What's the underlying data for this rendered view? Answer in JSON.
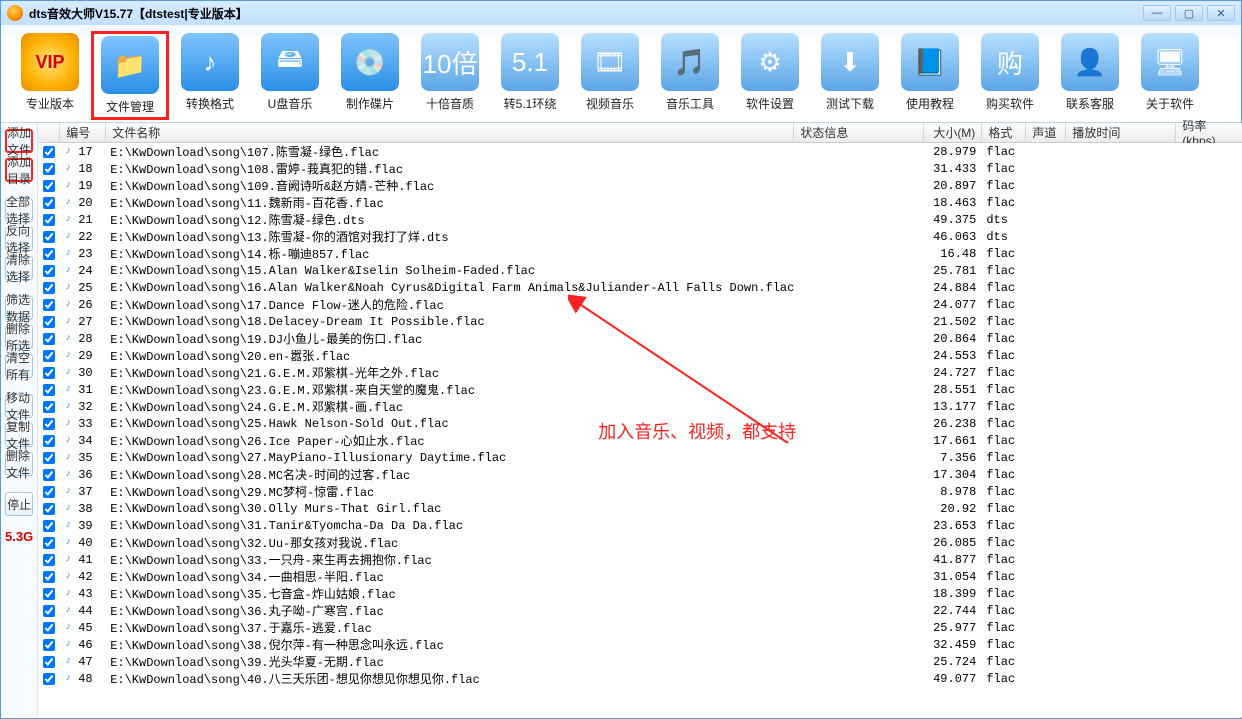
{
  "title": "dts音效大师V15.77【dtstest|专业版本】",
  "winbtns": {
    "min": "—",
    "max": "▢",
    "close": "✕"
  },
  "toolbar": [
    {
      "id": "vip",
      "label": "专业版本",
      "icon": "VIP"
    },
    {
      "id": "file-mgr",
      "label": "文件管理",
      "icon": "📁"
    },
    {
      "id": "convert",
      "label": "转换格式",
      "icon": "♪"
    },
    {
      "id": "usb",
      "label": "U盘音乐",
      "icon": "🖴"
    },
    {
      "id": "make-disc",
      "label": "制作碟片",
      "icon": "💿"
    },
    {
      "id": "ten-x",
      "label": "十倍音质",
      "icon": "10倍"
    },
    {
      "id": "to51",
      "label": "转5.1环绕",
      "icon": "5.1"
    },
    {
      "id": "video",
      "label": "视频音乐",
      "icon": "🎞"
    },
    {
      "id": "tools",
      "label": "音乐工具",
      "icon": "🎵"
    },
    {
      "id": "settings",
      "label": "软件设置",
      "icon": "⚙"
    },
    {
      "id": "test-dl",
      "label": "测试下载",
      "icon": "⬇"
    },
    {
      "id": "tutorial",
      "label": "使用教程",
      "icon": "📘"
    },
    {
      "id": "buy",
      "label": "购买软件",
      "icon": "购"
    },
    {
      "id": "contact",
      "label": "联系客服",
      "icon": "👤"
    },
    {
      "id": "about",
      "label": "关于软件",
      "icon": "🖥"
    }
  ],
  "sidebar": [
    {
      "id": "add-file",
      "label": "添加文件",
      "hl": true
    },
    {
      "id": "add-dir",
      "label": "添加目录",
      "hl": true
    },
    {
      "gap": true
    },
    {
      "id": "select-all",
      "label": "全部选择"
    },
    {
      "id": "select-inv",
      "label": "反向选择"
    },
    {
      "id": "clear-sel",
      "label": "清除选择"
    },
    {
      "gap": true
    },
    {
      "id": "filter",
      "label": "筛选数据"
    },
    {
      "id": "del-sel",
      "label": "删除所选"
    },
    {
      "id": "clear-all",
      "label": "清空所有"
    },
    {
      "gap": true
    },
    {
      "id": "move",
      "label": "移动文件"
    },
    {
      "id": "copy",
      "label": "复制文件"
    },
    {
      "id": "del-file",
      "label": "删除文件"
    },
    {
      "gap": true
    },
    {
      "id": "stop",
      "label": "停止"
    }
  ],
  "size_info": "5.3G",
  "columns": {
    "num": "编号",
    "name": "文件名称",
    "status": "状态信息",
    "size": "大小(M)",
    "fmt": "格式",
    "snd": "声道",
    "ptime": "播放时间",
    "rate": "码率(kbps)"
  },
  "annotation": "加入音乐、视频，都支持",
  "rows": [
    {
      "n": "17",
      "name": "E:\\KwDownload\\song\\107.陈雪凝-绿色.flac",
      "size": "28.979",
      "fmt": "flac"
    },
    {
      "n": "18",
      "name": "E:\\KwDownload\\song\\108.雷婷-莪真犯的错.flac",
      "size": "31.433",
      "fmt": "flac"
    },
    {
      "n": "19",
      "name": "E:\\KwDownload\\song\\109.音阙诗听&赵方婧-芒种.flac",
      "size": "20.897",
      "fmt": "flac"
    },
    {
      "n": "20",
      "name": "E:\\KwDownload\\song\\11.魏新雨-百花香.flac",
      "size": "18.463",
      "fmt": "flac"
    },
    {
      "n": "21",
      "name": "E:\\KwDownload\\song\\12.陈雪凝-绿色.dts",
      "size": "49.375",
      "fmt": "dts"
    },
    {
      "n": "22",
      "name": "E:\\KwDownload\\song\\13.陈雪凝-你的酒馆对我打了烊.dts",
      "size": "46.063",
      "fmt": "dts"
    },
    {
      "n": "23",
      "name": "E:\\KwDownload\\song\\14.栎-嘣迪857.flac",
      "size": "16.48",
      "fmt": "flac"
    },
    {
      "n": "24",
      "name": "E:\\KwDownload\\song\\15.Alan Walker&Iselin Solheim-Faded.flac",
      "size": "25.781",
      "fmt": "flac"
    },
    {
      "n": "25",
      "name": "E:\\KwDownload\\song\\16.Alan Walker&Noah Cyrus&Digital Farm Animals&Juliander-All Falls Down.flac",
      "size": "24.884",
      "fmt": "flac"
    },
    {
      "n": "26",
      "name": "E:\\KwDownload\\song\\17.Dance Flow-迷人的危险.flac",
      "size": "24.077",
      "fmt": "flac"
    },
    {
      "n": "27",
      "name": "E:\\KwDownload\\song\\18.Delacey-Dream It Possible.flac",
      "size": "21.502",
      "fmt": "flac"
    },
    {
      "n": "28",
      "name": "E:\\KwDownload\\song\\19.DJ小鱼儿-最美的伤口.flac",
      "size": "20.864",
      "fmt": "flac"
    },
    {
      "n": "29",
      "name": "E:\\KwDownload\\song\\20.en-嚣张.flac",
      "size": "24.553",
      "fmt": "flac"
    },
    {
      "n": "30",
      "name": "E:\\KwDownload\\song\\21.G.E.M.邓紫棋-光年之外.flac",
      "size": "24.727",
      "fmt": "flac"
    },
    {
      "n": "31",
      "name": "E:\\KwDownload\\song\\23.G.E.M.邓紫棋-来自天堂的魔鬼.flac",
      "size": "28.551",
      "fmt": "flac"
    },
    {
      "n": "32",
      "name": "E:\\KwDownload\\song\\24.G.E.M.邓紫棋-画.flac",
      "size": "13.177",
      "fmt": "flac"
    },
    {
      "n": "33",
      "name": "E:\\KwDownload\\song\\25.Hawk Nelson-Sold Out.flac",
      "size": "26.238",
      "fmt": "flac"
    },
    {
      "n": "34",
      "name": "E:\\KwDownload\\song\\26.Ice Paper-心如止水.flac",
      "size": "17.661",
      "fmt": "flac"
    },
    {
      "n": "35",
      "name": "E:\\KwDownload\\song\\27.MayPiano-Illusionary Daytime.flac",
      "size": "7.356",
      "fmt": "flac"
    },
    {
      "n": "36",
      "name": "E:\\KwDownload\\song\\28.MC名决-时间的过客.flac",
      "size": "17.304",
      "fmt": "flac"
    },
    {
      "n": "37",
      "name": "E:\\KwDownload\\song\\29.MC梦柯-惊雷.flac",
      "size": "8.978",
      "fmt": "flac"
    },
    {
      "n": "38",
      "name": "E:\\KwDownload\\song\\30.Olly Murs-That Girl.flac",
      "size": "20.92",
      "fmt": "flac"
    },
    {
      "n": "39",
      "name": "E:\\KwDownload\\song\\31.Tanir&Tyomcha-Da Da Da.flac",
      "size": "23.653",
      "fmt": "flac"
    },
    {
      "n": "40",
      "name": "E:\\KwDownload\\song\\32.Uu-那女孩对我说.flac",
      "size": "26.085",
      "fmt": "flac"
    },
    {
      "n": "41",
      "name": "E:\\KwDownload\\song\\33.一只舟-来生再去拥抱你.flac",
      "size": "41.877",
      "fmt": "flac"
    },
    {
      "n": "42",
      "name": "E:\\KwDownload\\song\\34.一曲相思-半阳.flac",
      "size": "31.054",
      "fmt": "flac"
    },
    {
      "n": "43",
      "name": "E:\\KwDownload\\song\\35.七音盒-炸山姑娘.flac",
      "size": "18.399",
      "fmt": "flac"
    },
    {
      "n": "44",
      "name": "E:\\KwDownload\\song\\36.丸子呦-广寒宫.flac",
      "size": "22.744",
      "fmt": "flac"
    },
    {
      "n": "45",
      "name": "E:\\KwDownload\\song\\37.于嘉乐-逃爱.flac",
      "size": "25.977",
      "fmt": "flac"
    },
    {
      "n": "46",
      "name": "E:\\KwDownload\\song\\38.倪尔萍-有一种思念叫永远.flac",
      "size": "32.459",
      "fmt": "flac"
    },
    {
      "n": "47",
      "name": "E:\\KwDownload\\song\\39.光头华夏-无期.flac",
      "size": "25.724",
      "fmt": "flac"
    },
    {
      "n": "48",
      "name": "E:\\KwDownload\\song\\40.八三夭乐团-想见你想见你想见你.flac",
      "size": "49.077",
      "fmt": "flac"
    }
  ]
}
